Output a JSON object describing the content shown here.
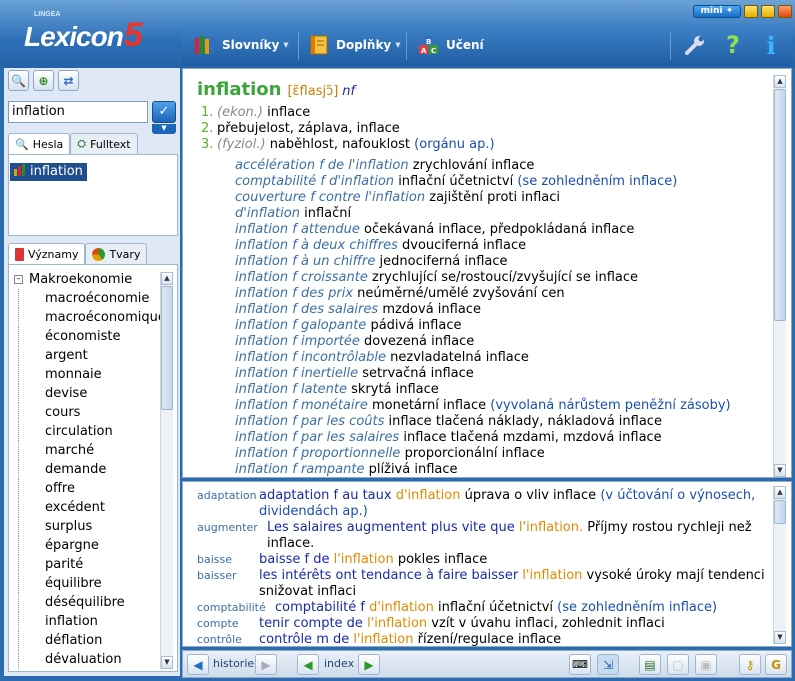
{
  "app": {
    "logo_main": "Lexicon",
    "logo_number": "5",
    "logo_brand": "LINGEA",
    "mini_label": "mini"
  },
  "toolbar": {
    "dictionaries_label": "Slovníky",
    "addons_label": "Doplňky",
    "learning_label": "Učení"
  },
  "search": {
    "value": "inflation"
  },
  "left_tabs": {
    "entries_label": "Hesla",
    "fulltext_label": "Fulltext",
    "meanings_label": "Významy",
    "forms_label": "Tvary"
  },
  "results": [
    "inflation"
  ],
  "tree": {
    "root": "Makroekonomie",
    "items": [
      "macroéconomie",
      "macroéconomique",
      "économiste",
      "argent",
      "monnaie",
      "devise",
      "cours",
      "circulation",
      "marché",
      "demande",
      "offre",
      "excédent",
      "surplus",
      "épargne",
      "parité",
      "équilibre",
      "déséquilibre",
      "inflation",
      "déflation",
      "dévaluation"
    ]
  },
  "entry": {
    "headword": "inflation",
    "pronunciation": "[ɛ̃flasjɔ̃]",
    "pos": "nf",
    "senses": [
      {
        "num": "1.",
        "label": "(ekon.)",
        "text": "inflace",
        "note": ""
      },
      {
        "num": "2.",
        "label": "",
        "text": "přebujelost, záplava, inflace",
        "note": ""
      },
      {
        "num": "3.",
        "label": "(fyziol.)",
        "text": "naběhlost, nafouklost",
        "note": "(orgánu ap.)"
      }
    ],
    "phrases": [
      {
        "fr": "accélération f de l'inflation",
        "cz": "zrychlování inflace",
        "note": ""
      },
      {
        "fr": "comptabilité f d'inflation",
        "cz": "inflační účetnictví",
        "note": "(se zohledněním inflace)"
      },
      {
        "fr": "couverture f contre l'inflation",
        "cz": "zajištění proti inflaci",
        "note": ""
      },
      {
        "fr": "d'inflation",
        "cz": "inflační",
        "note": ""
      },
      {
        "fr": "inflation f attendue",
        "cz": "očekávaná inflace, předpokládaná inflace",
        "note": ""
      },
      {
        "fr": "inflation f à deux chiffres",
        "cz": "dvouciferná inflace",
        "note": ""
      },
      {
        "fr": "inflation f à un chiffre",
        "cz": "jednociferná inflace",
        "note": ""
      },
      {
        "fr": "inflation f croissante",
        "cz": "zrychlující se/rostoucí/zvyšující se inflace",
        "note": ""
      },
      {
        "fr": "inflation f des prix",
        "cz": "neúměrné/umělé zvyšování cen",
        "note": ""
      },
      {
        "fr": "inflation f des salaires",
        "cz": "mzdová inflace",
        "note": ""
      },
      {
        "fr": "inflation f galopante",
        "cz": "pádivá inflace",
        "note": ""
      },
      {
        "fr": "inflation f importée",
        "cz": "dovezená inflace",
        "note": ""
      },
      {
        "fr": "inflation f incontrôlable",
        "cz": "nezvladatelná inflace",
        "note": ""
      },
      {
        "fr": "inflation f inertielle",
        "cz": "setrvačná inflace",
        "note": ""
      },
      {
        "fr": "inflation f latente",
        "cz": "skrytá inflace",
        "note": ""
      },
      {
        "fr": "inflation f monétaire",
        "cz": "monetární inflace",
        "note": "(vyvolaná nárůstem peněžní zásoby)"
      },
      {
        "fr": "inflation f par les coûts",
        "cz": "inflace tlačená náklady, nákladová inflace",
        "note": ""
      },
      {
        "fr": "inflation f par les salaires",
        "cz": "inflace tlačená mzdami, mzdová inflace",
        "note": ""
      },
      {
        "fr": "inflation f proportionnelle",
        "cz": "proporcionální inflace",
        "note": ""
      },
      {
        "fr": "inflation f rampante",
        "cz": "plíživá inflace",
        "note": ""
      }
    ]
  },
  "examples": [
    {
      "kw": "adaptation",
      "pre": "adaptation f au taux ",
      "hl": "d'inflation",
      "post": "",
      "cz": "úprava o vliv inflace",
      "note": "(v účtování o výnosech, dividendách ap.)"
    },
    {
      "kw": "augmenter",
      "pre": "Les salaires augmentent plus vite que ",
      "hl": "l'inflation.",
      "post": "",
      "cz": "Příjmy rostou rychleji než inflace.",
      "note": ""
    },
    {
      "kw": "baisse",
      "pre": "baisse f de ",
      "hl": "l'inflation",
      "post": "",
      "cz": "pokles inflace",
      "note": ""
    },
    {
      "kw": "baisser",
      "pre": "les intérêts ont tendance à faire baisser ",
      "hl": "l'inflation",
      "post": "",
      "cz": "vysoké úroky mají tendenci snižovat inflaci",
      "note": ""
    },
    {
      "kw": "comptabilité",
      "pre": "comptabilité f ",
      "hl": "d'inflation",
      "post": "",
      "cz": "inflační účetnictví",
      "note": "(se zohledněním inflace)"
    },
    {
      "kw": "compte",
      "pre": "tenir compte de ",
      "hl": "l'inflation",
      "post": "",
      "cz": "vzít v úvahu inflaci, zohlednit inflaci",
      "note": ""
    },
    {
      "kw": "contrôle",
      "pre": "contrôle m de ",
      "hl": "l'inflation",
      "post": "",
      "cz": "řízení/regulace inflace",
      "note": ""
    }
  ],
  "nav": {
    "history_label": "historie",
    "index_label": "index"
  }
}
